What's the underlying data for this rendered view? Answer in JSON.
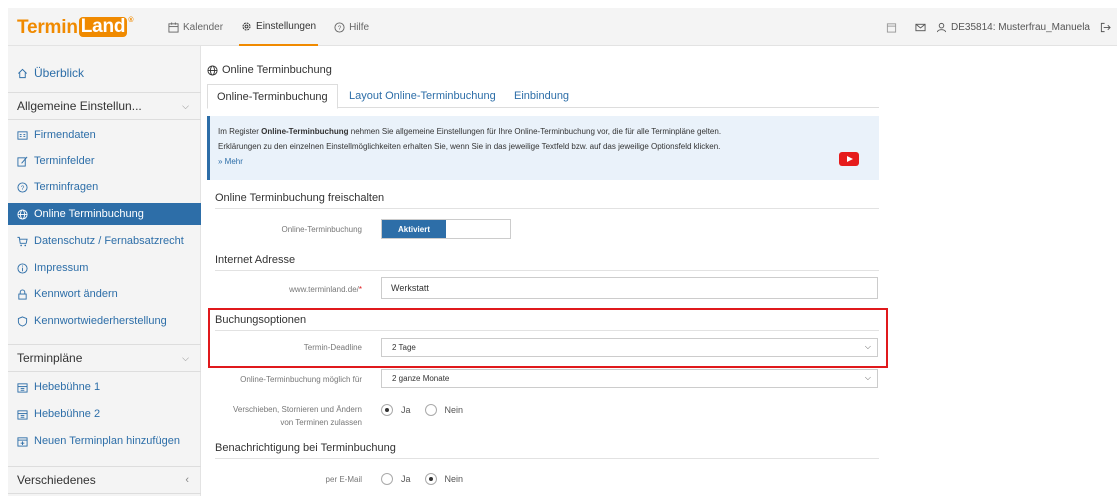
{
  "app": {
    "logo_a": "Termin",
    "logo_b": "Land",
    "logo_reg": "®"
  },
  "nav": {
    "kalender": "Kalender",
    "einstellungen": "Einstellungen",
    "hilfe": "Hilfe",
    "user": "DE35814: Musterfrau_Manuela"
  },
  "sidebar": {
    "overview": "Überblick",
    "head_general": "Allgemeine Einstellun...",
    "items": [
      "Firmendaten",
      "Terminfelder",
      "Terminfragen",
      "Online Terminbuchung",
      "Datenschutz / Fernabsatzrecht",
      "Impressum",
      "Kennwort ändern",
      "Kennwortwiederherstellung"
    ],
    "head_plans": "Terminpläne",
    "plans": [
      "Hebebühne 1",
      "Hebebühne 2",
      "Neuen Terminplan hinzufügen"
    ],
    "head_misc": "Verschiedenes"
  },
  "main": {
    "breadcrumb": "Online Terminbuchung",
    "tabs": [
      "Online-Terminbuchung",
      "Layout Online-Terminbuchung",
      "Einbindung"
    ],
    "info": {
      "line1_pre": "Im Register ",
      "line1_bold": "Online-Terminbuchung",
      "line1_post": " nehmen Sie allgemeine Einstellungen für Ihre Online-Terminbuchung vor, die für alle Terminpläne gelten.",
      "line2": "Erklärungen zu den einzelnen Einstellmöglichkeiten erhalten Sie, wenn Sie in das jeweilige Textfeld bzw. auf das jeweilige Optionsfeld klicken.",
      "more": "» Mehr"
    },
    "sec_unlock": "Online Terminbuchung freischalten",
    "lbl_online": "Online-Terminbuchung",
    "toggle_on": "Aktiviert",
    "sec_address": "Internet Adresse",
    "lbl_url": "www.terminland.de/",
    "url_value": "Werkstatt",
    "sec_options": "Buchungsoptionen",
    "lbl_deadline": "Termin-Deadline",
    "deadline_value": "2 Tage",
    "lbl_possible": "Online-Terminbuchung möglich für",
    "possible_value": "2 ganze Monate",
    "lbl_move_1": "Verschieben, Stornieren und Ändern",
    "lbl_move_2": "von Terminen zulassen",
    "opt_ja": "Ja",
    "opt_nein": "Nein",
    "sec_notify": "Benachrichtigung bei Terminbuchung",
    "lbl_email": "per E-Mail"
  },
  "colors": {
    "accent": "#f08a00",
    "primary": "#2d6ea8",
    "highlight": "#e0191c"
  }
}
